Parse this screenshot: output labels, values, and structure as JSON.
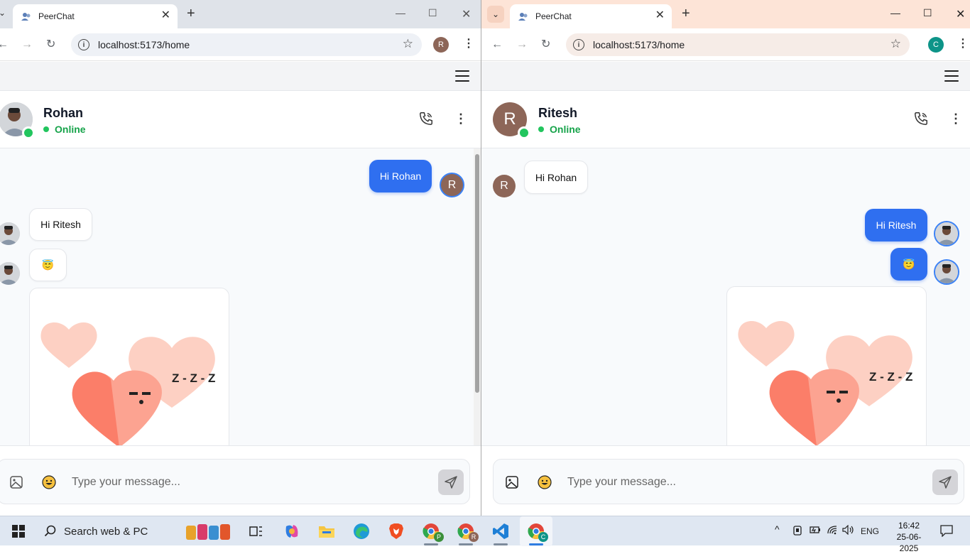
{
  "left": {
    "tab_title": "PeerChat",
    "url": "localhost:5173/home",
    "profile_initial": "R",
    "contact_name": "Rohan",
    "contact_status": "Online",
    "messages": [
      {
        "dir": "out",
        "text": "Hi Rohan",
        "avatar_initial": "R"
      },
      {
        "dir": "in",
        "text": "Hi Ritesh"
      },
      {
        "dir": "in",
        "text": "😇"
      },
      {
        "dir": "in",
        "type": "sticker",
        "text": "Z - Z - Z"
      }
    ],
    "composer_placeholder": "Type your message..."
  },
  "right": {
    "tab_title": "PeerChat",
    "url": "localhost:5173/home",
    "profile_initial": "C",
    "contact_initial": "R",
    "contact_name": "Ritesh",
    "contact_status": "Online",
    "messages": [
      {
        "dir": "in",
        "text": "Hi Rohan",
        "avatar_initial": "R"
      },
      {
        "dir": "out",
        "text": "Hi Ritesh"
      },
      {
        "dir": "out",
        "text": "😇"
      },
      {
        "dir": "out",
        "type": "sticker",
        "text": "Z - Z - Z"
      }
    ],
    "composer_placeholder": "Type your message..."
  },
  "taskbar": {
    "search_label": "Search web & PC",
    "language": "ENG",
    "time": "16:42",
    "date": "25-06-2025",
    "chrome_badges": [
      "P",
      "R",
      "C"
    ]
  },
  "colors": {
    "accent": "#2f6ff0",
    "online": "#22c55e",
    "avatar_brown": "#8d6658",
    "profile_teal": "#0d9488"
  }
}
